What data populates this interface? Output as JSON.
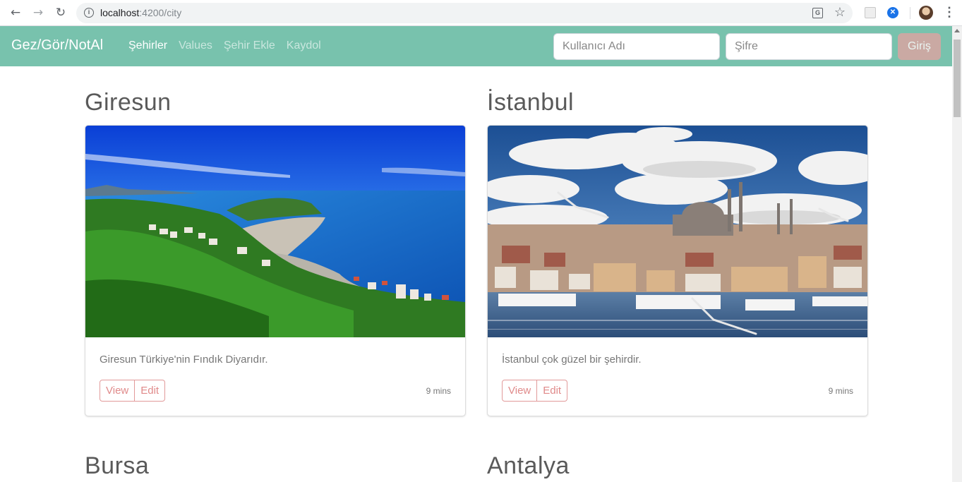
{
  "browser": {
    "url_host": "localhost",
    "url_path": ":4200/city",
    "icons": [
      "back-arrow-icon",
      "forward-arrow-icon",
      "reload-icon",
      "info-icon",
      "translate-icon",
      "star-icon",
      "extension-icon",
      "vpn-extension-icon",
      "profile-avatar",
      "kebab-menu-icon"
    ]
  },
  "navbar": {
    "brand": "Gez/Gör/NotAl",
    "links": [
      {
        "label": "Şehirler",
        "active": true
      },
      {
        "label": "Values",
        "active": false
      },
      {
        "label": "Şehir Ekle",
        "active": false
      },
      {
        "label": "Kaydol",
        "active": false
      }
    ],
    "username_placeholder": "Kullanıcı Adı",
    "password_placeholder": "Şifre",
    "login_label": "Giriş",
    "background": "#78c2ad"
  },
  "cities": [
    {
      "name": "Giresun",
      "description": "Giresun Türkiye'nin Fındık Diyarıdır.",
      "view_label": "View",
      "edit_label": "Edit",
      "time": "9 mins"
    },
    {
      "name": "İstanbul",
      "description": "İstanbul çok güzel bir şehirdir.",
      "view_label": "View",
      "edit_label": "Edit",
      "time": "9 mins"
    },
    {
      "name": "Bursa"
    },
    {
      "name": "Antalya"
    }
  ],
  "colors": {
    "accent": "#78c2ad",
    "button_outline": "#e29a9a",
    "login_button": "#d9a5a2"
  }
}
